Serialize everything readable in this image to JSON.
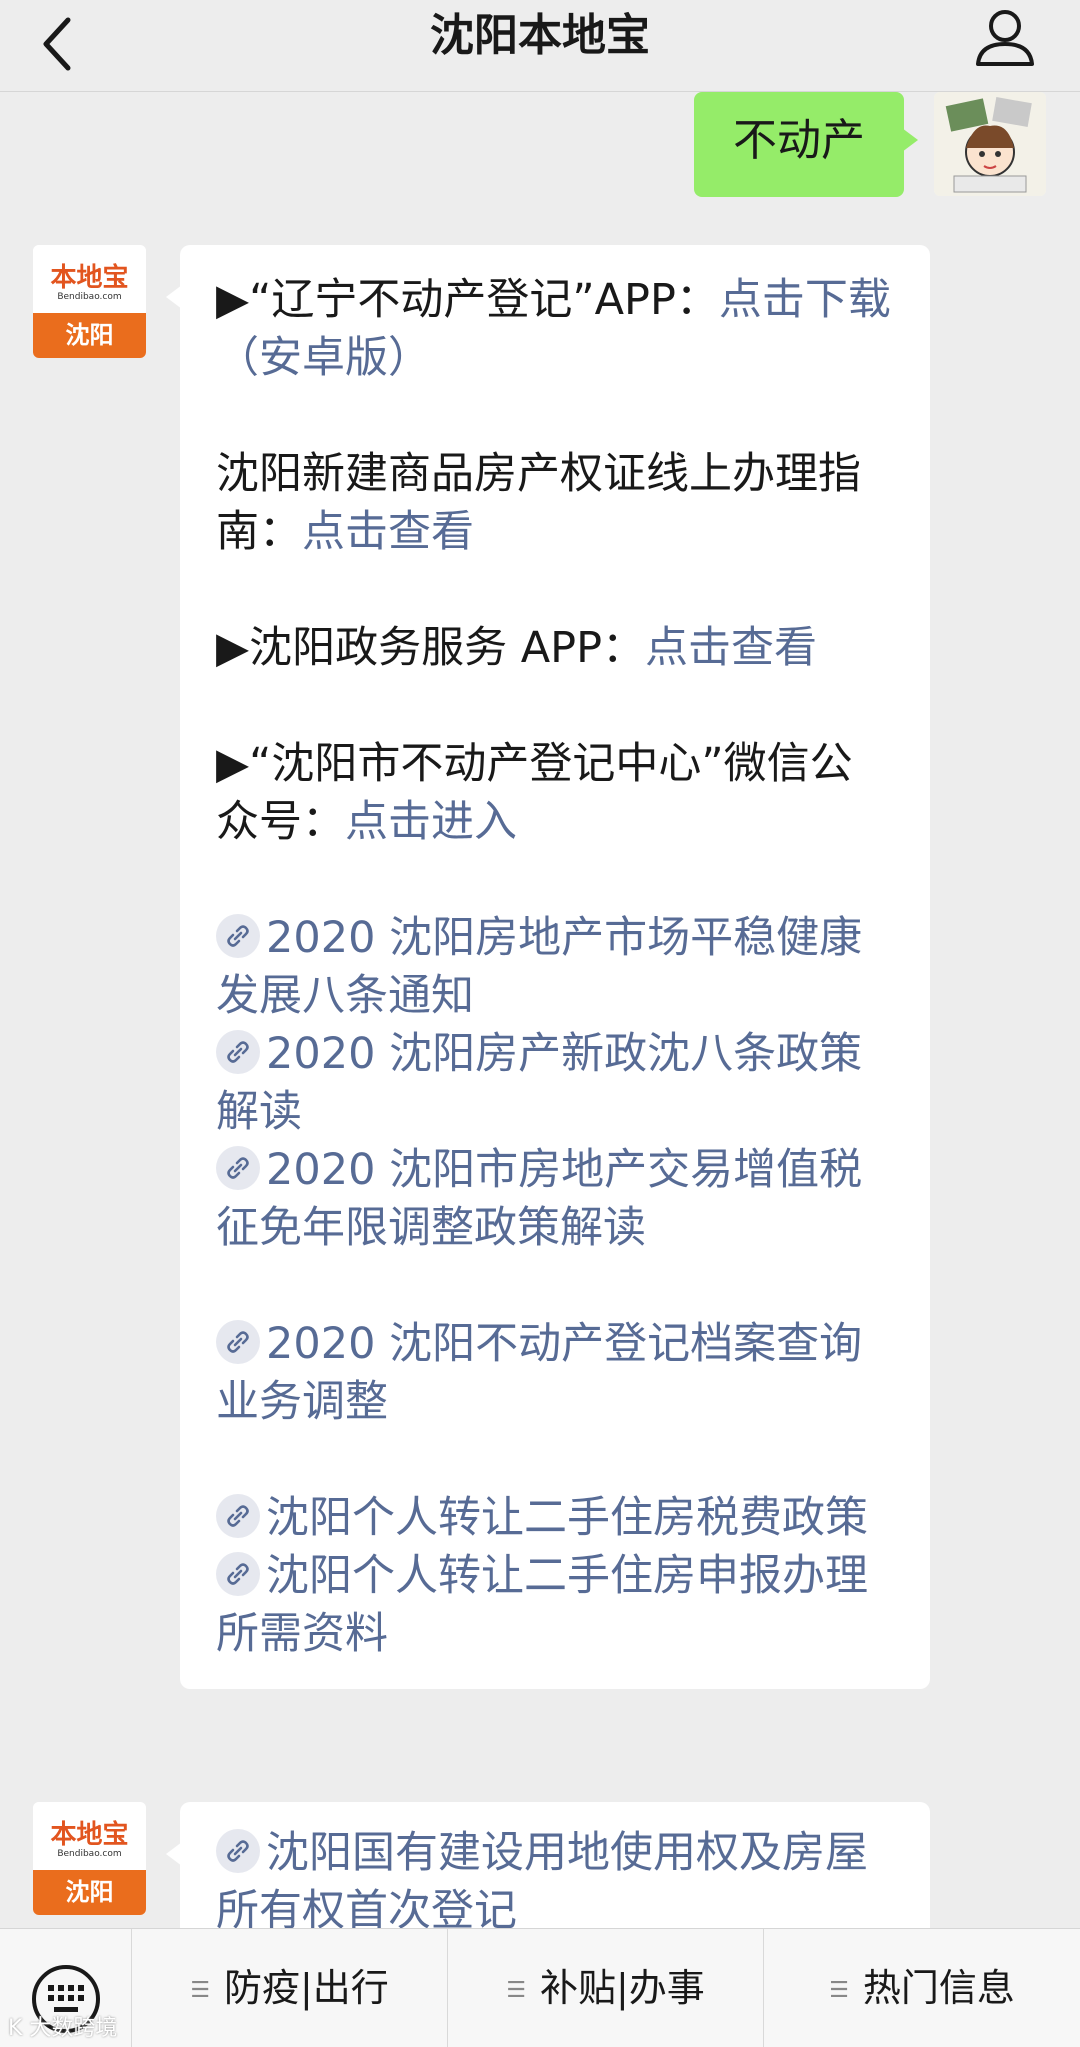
{
  "header": {
    "title": "沈阳本地宝"
  },
  "self_message": {
    "text": "不动产"
  },
  "bot_avatar": {
    "brand": "本地宝",
    "domain": "Bendibao.com",
    "city": "沈阳"
  },
  "bubble1": {
    "p1_prefix": "▶“辽宁不动产登记”APP：",
    "p1_link": "点击下载（安卓版）",
    "p2_prefix": "沈阳新建商品房产权证线上办理指南：",
    "p2_link": "点击查看",
    "p3_prefix": "▶沈阳政务服务 APP：",
    "p3_link": "点击查看",
    "p4_prefix": "▶“沈阳市不动产登记中心”微信公众号：",
    "p4_link": "点击进入",
    "links_a": [
      "2020 沈阳房地产市场平稳健康发展八条通知",
      "2020 沈阳房产新政沈八条政策解读",
      "2020 沈阳市房地产交易增值税征免年限调整政策解读"
    ],
    "links_b": [
      "2020 沈阳不动产登记档案查询业务调整"
    ],
    "links_c": [
      "沈阳个人转让二手住房税费政策",
      "沈阳个人转让二手住房申报办理所需资料"
    ]
  },
  "bubble2": {
    "link": "沈阳国有建设用地使用权及房屋所有权首次登记"
  },
  "menu": {
    "items": [
      "防疫|出行",
      "补贴|办事",
      "热门信息"
    ]
  },
  "watermark": "K 大数跨境"
}
